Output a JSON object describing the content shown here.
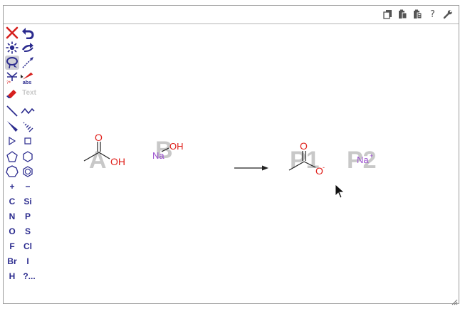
{
  "topbar": {
    "icons": [
      "copy-icon",
      "paste-icon",
      "paste-special-icon",
      "help-icon",
      "settings-wrench-icon"
    ],
    "help_label": "?"
  },
  "toolbox": {
    "tools": [
      "clear-icon",
      "undo-icon",
      "clean-icon",
      "redo-icon",
      "lasso-select-icon",
      "arrow-tool-icon",
      "reaction-icon",
      "stereo-icon",
      "eraser-icon",
      "text-tool-icon",
      "single-bond-icon",
      "chain-icon",
      "wedge-bond-icon",
      "hash-bond-icon",
      "triangle-icon",
      "square-icon",
      "pentagon-icon",
      "hexagon-icon",
      "heptagon-icon",
      "benzene-icon",
      "plus-charge-icon",
      "minus-charge-icon"
    ],
    "stereo_label": "abs",
    "text_label": "Text",
    "plus_label": "+",
    "minus_label": "−",
    "atoms": [
      "C",
      "Si",
      "N",
      "P",
      "O",
      "S",
      "F",
      "Cl",
      "Br",
      "I",
      "H",
      "?..."
    ]
  },
  "canvas": {
    "reactant_a": {
      "label": "A",
      "o_label": "O",
      "oh_label": "OH"
    },
    "reactant_b": {
      "label": "B",
      "na_label": "Na",
      "oh_label": "OH"
    },
    "product_1": {
      "label": "P1",
      "o_label": "O",
      "ominus_label": "O",
      "charge": "-"
    },
    "product_2": {
      "label": "P2",
      "na_label": "Na",
      "charge": "+"
    }
  },
  "colors": {
    "accent": "#2b2b8e",
    "oxygen": "#e0201b",
    "sodium": "#9b4fd0",
    "label_gray": "#c8c8c8",
    "clear_red": "#d6201e"
  }
}
